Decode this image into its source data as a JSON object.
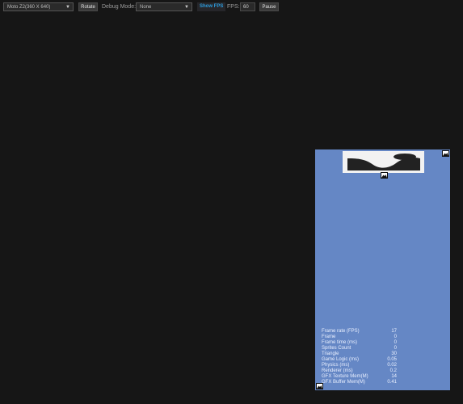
{
  "toolbar": {
    "device_select": "Moto Z2(360 X 640)",
    "rotate_label": "Rotate",
    "debug_mode_label": "Debug Mode:",
    "debug_mode_value": "None",
    "show_fps_label": "Show FPS",
    "fps_label": "FPS:",
    "fps_value": "60",
    "pause_label": "Pause"
  },
  "device": {
    "background_color": "#6587c5",
    "stats": [
      {
        "label": "Frame rate (FPS)",
        "value": "17"
      },
      {
        "label": "Frame",
        "value": "0"
      },
      {
        "label": "Frame time (ms)",
        "value": "0"
      },
      {
        "label": "Sprites Count",
        "value": "0"
      },
      {
        "label": "Triangle",
        "value": "30"
      },
      {
        "label": "Game Logic (ms)",
        "value": "0.05"
      },
      {
        "label": "Physics (ms)",
        "value": "0.02"
      },
      {
        "label": "Renderer (ms)",
        "value": "0.2"
      },
      {
        "label": "GFX Texture Mem(M)",
        "value": "14"
      },
      {
        "label": "GFX Buffer Mem(M)",
        "value": "0.41"
      }
    ]
  },
  "icons": {
    "chevron": "chevron-down-icon",
    "image_placeholder": "image-icon"
  }
}
